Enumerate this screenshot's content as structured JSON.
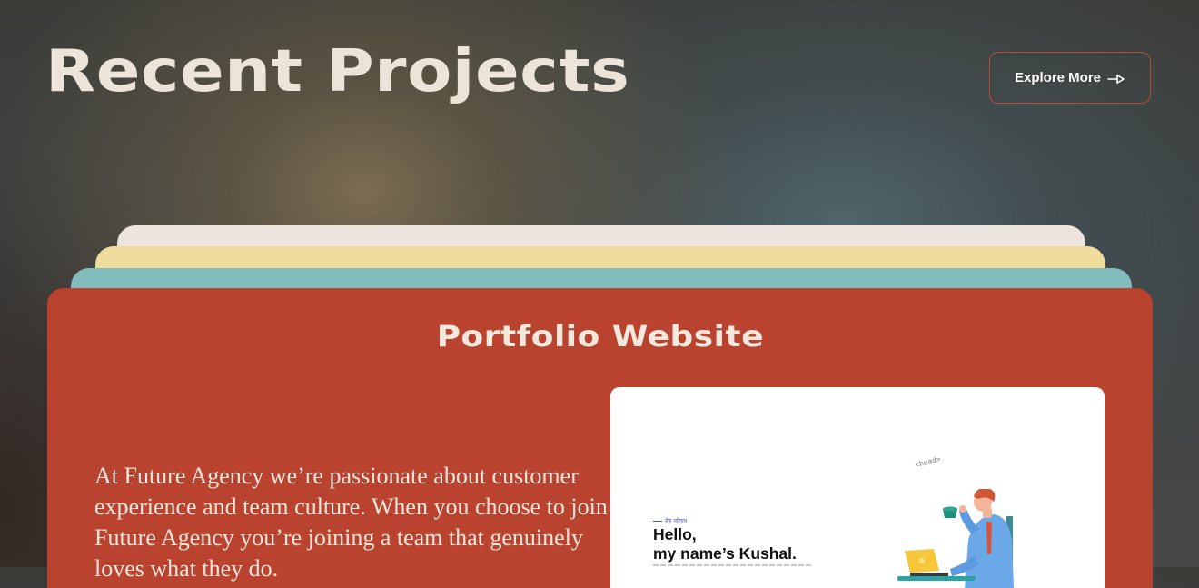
{
  "header": {
    "title": "Recent Projects",
    "explore_label": "Explore More"
  },
  "project": {
    "title": "Portfolio Website",
    "description": "At Future Agency we’re passionate about customer experience and team culture. When you choose to join Future Agency you’re joining a team that genuinely loves what they do.",
    "preview": {
      "eyebrow": "मेरा परिचय",
      "greeting": "Hello,",
      "name_line": "my name’s Kushal.",
      "code_tag": "<head>"
    }
  },
  "icons": {
    "explore_arrow": "arrow-right-icon",
    "illustration": "developer-illustration-icon"
  },
  "colors": {
    "card_primary": "#b9432f",
    "card_teal": "#80bcbc",
    "card_yellow": "#f0dd9d",
    "card_cream": "#ede5dd",
    "button_border": "#b94a36",
    "title_text": "#ece3d9"
  }
}
